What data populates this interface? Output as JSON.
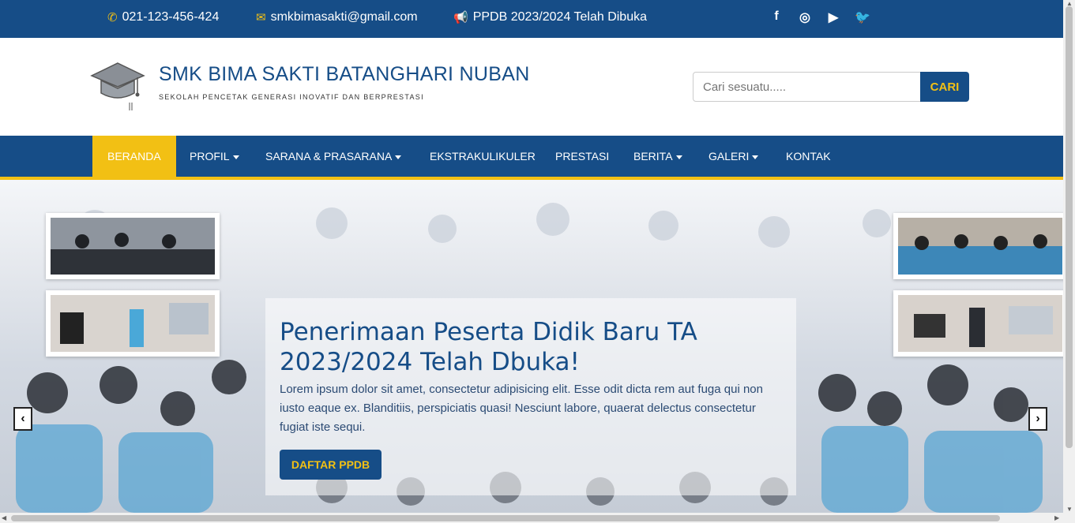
{
  "topbar": {
    "phone": "021-123-456-424",
    "email": "smkbimasakti@gmail.com",
    "announcement": "PPDB 2023/2024 Telah Dibuka",
    "icons": [
      "phone-icon",
      "envelope-icon",
      "megaphone-icon"
    ],
    "social": [
      {
        "name": "facebook-icon",
        "glyph": "f"
      },
      {
        "name": "instagram-icon",
        "glyph": "◎"
      },
      {
        "name": "youtube-icon",
        "glyph": "▶"
      },
      {
        "name": "twitter-icon",
        "glyph": "🐦"
      }
    ]
  },
  "header": {
    "school_name": "SMK BIMA SAKTI BATANGHARI NUBAN",
    "tagline": "SEKOLAH PENCETAK GENERASI INOVATIF DAN BERPRESTASI",
    "search_placeholder": "Cari sesuatu.....",
    "search_button": "CARI"
  },
  "nav": {
    "items": [
      {
        "label": "BERANDA",
        "dropdown": false,
        "active": true
      },
      {
        "label": "PROFIL",
        "dropdown": true
      },
      {
        "label": "SARANA & PRASARANA",
        "dropdown": true
      },
      {
        "label": "EKSTRAKULIKULER",
        "dropdown": false
      },
      {
        "label": "PRESTASI",
        "dropdown": false
      },
      {
        "label": "BERITA",
        "dropdown": true
      },
      {
        "label": "GALERI",
        "dropdown": true
      },
      {
        "label": "KONTAK",
        "dropdown": false
      }
    ]
  },
  "hero": {
    "title": "Penerimaan Peserta Didik Baru TA 2023/2024 Telah Dbuka!",
    "body": "Lorem ipsum dolor sit amet, consectetur adipisicing elit. Esse odit dicta rem aut fuga qui non iusto eaque ex. Blanditiis, perspiciatis quasi! Nesciunt labore, quaerat delectus consectetur fugiat iste sequi.",
    "button": "DAFTAR PPDB",
    "prev": "‹",
    "next": "›"
  },
  "colors": {
    "primary": "#164d87",
    "accent": "#f2c014"
  }
}
